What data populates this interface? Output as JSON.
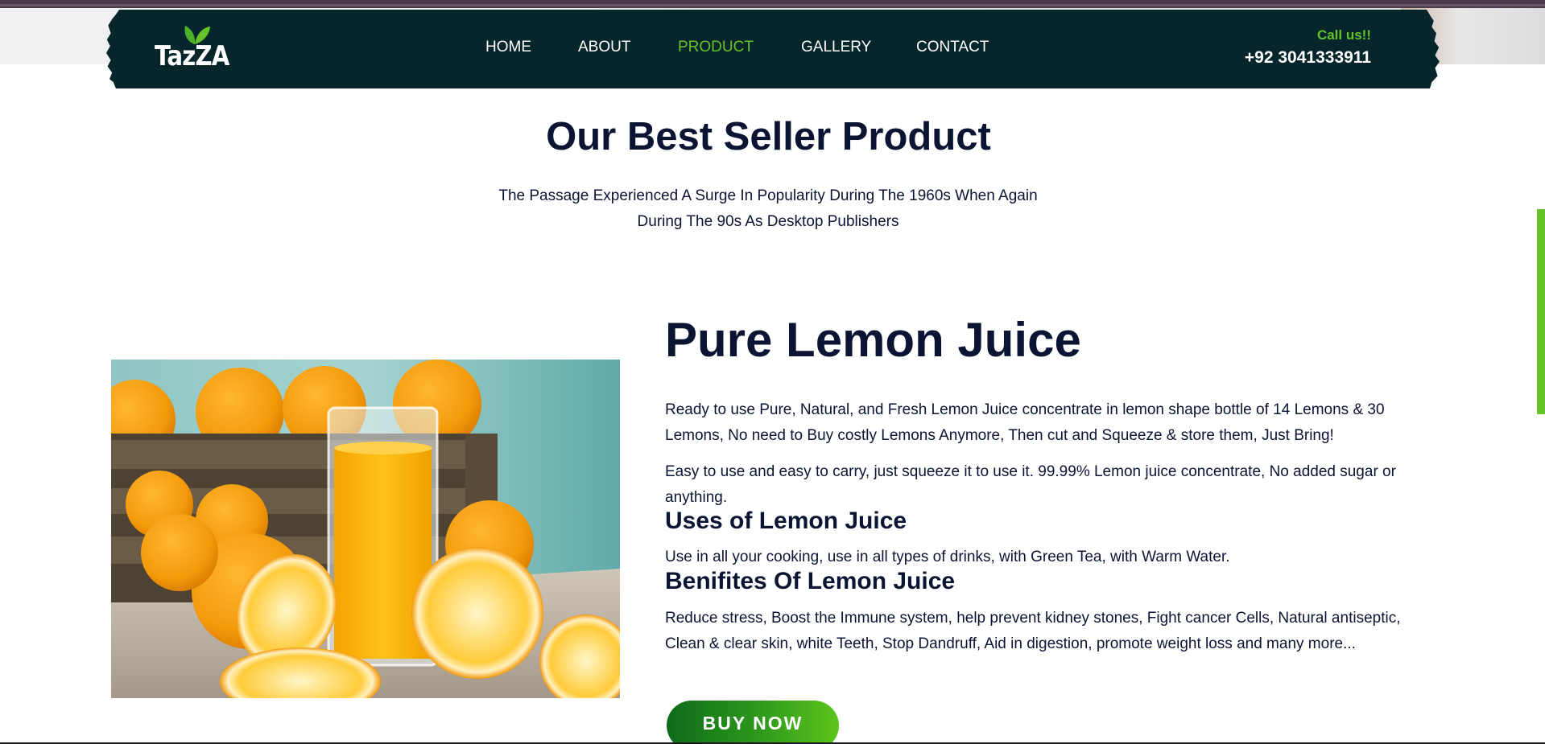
{
  "brand": {
    "logo_text": "TazZA"
  },
  "nav": {
    "items": [
      {
        "label": "HOME",
        "active": false
      },
      {
        "label": "ABOUT",
        "active": false
      },
      {
        "label": "PRODUCT",
        "active": true
      },
      {
        "label": "GALLERY",
        "active": false
      },
      {
        "label": "CONTACT",
        "active": false
      }
    ]
  },
  "contact": {
    "call_label": "Call us!!",
    "phone": "+92 3041333911"
  },
  "section": {
    "title": "Our Best Seller Product",
    "subtitle": "The Passage Experienced A Surge In Popularity During The 1960s When Again During The 90s As Desktop Publishers"
  },
  "product": {
    "image_name": "orange-juice-photo",
    "name": "Pure Lemon Juice",
    "description_1": "Ready to use Pure, Natural, and Fresh Lemon Juice concentrate in lemon shape bottle of 14 Lemons & 30 Lemons, No need to Buy costly Lemons Anymore, Then cut and Squeeze & store them, Just Bring!",
    "description_2": "Easy to use and easy to carry, just squeeze it to use it. 99.99% Lemon juice concentrate, No added sugar or anything.",
    "uses_heading": "Uses of Lemon Juice",
    "uses_text": "Use in all your cooking, use in all types of drinks, with Green Tea, with Warm Water.",
    "benefits_heading": "Benifites Of Lemon Juice",
    "benefits_text": "Reduce stress, Boost the Immune system, help prevent kidney stones, Fight cancer Cells, Natural antiseptic, Clean & clear skin, white Teeth, Stop Dandruff, Aid in digestion, promote weight loss and many more...",
    "buy_label": "BUY NOW"
  },
  "colors": {
    "nav_bg": "#06262b",
    "accent_green": "#66c22a",
    "heading_text": "#0b1433",
    "button_gradient_start": "#0d6b1a",
    "button_gradient_end": "#5cc51b"
  }
}
